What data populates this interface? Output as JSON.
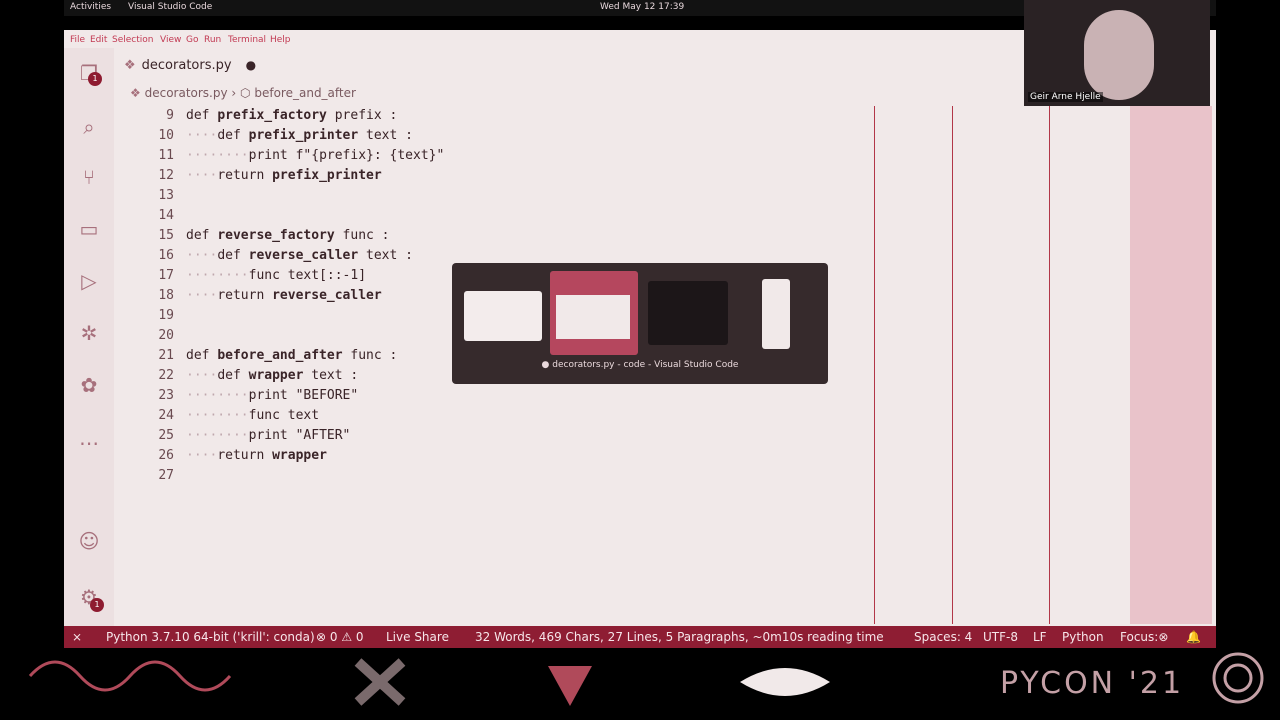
{
  "gnome": {
    "activities": "Activities",
    "app": "Visual Studio Code",
    "clock": "Wed May 12 17:39"
  },
  "menu": [
    "File",
    "Edit",
    "Selection",
    "View",
    "Go",
    "Run",
    "Terminal",
    "Help"
  ],
  "tab": {
    "filename": "decorators.py"
  },
  "breadcrumb": {
    "file": "decorators.py",
    "symbol": "before_and_after"
  },
  "activity_badges": {
    "explorer": "1",
    "accounts": "1"
  },
  "code": [
    {
      "n": "9",
      "kw": "def",
      "name": "prefix_factory",
      "rest": " prefix :"
    },
    {
      "n": "10",
      "ind": "····",
      "kw": "def",
      "name": "prefix_printer",
      "rest": " text :"
    },
    {
      "n": "11",
      "ind": "········",
      "kw": "print",
      "rest": " f\"{prefix}: {text}\""
    },
    {
      "n": "12",
      "ind": "····",
      "kw": "return",
      "name": "prefix_printer",
      "rest": ""
    },
    {
      "n": "13"
    },
    {
      "n": "14"
    },
    {
      "n": "15",
      "kw": "def",
      "name": "reverse_factory",
      "rest": " func :"
    },
    {
      "n": "16",
      "ind": "····",
      "kw": "def",
      "name": "reverse_caller",
      "rest": " text :"
    },
    {
      "n": "17",
      "ind": "········",
      "rest": "func text[::-1]"
    },
    {
      "n": "18",
      "ind": "····",
      "kw": "return",
      "name": "reverse_caller",
      "rest": ""
    },
    {
      "n": "19"
    },
    {
      "n": "20"
    },
    {
      "n": "21",
      "kw": "def",
      "name": "before_and_after",
      "rest": " func :"
    },
    {
      "n": "22",
      "ind": "····",
      "kw": "def",
      "name": "wrapper",
      "rest": " text :"
    },
    {
      "n": "23",
      "ind": "········",
      "kw": "print",
      "rest": " \"BEFORE\""
    },
    {
      "n": "24",
      "ind": "········",
      "rest": "func text"
    },
    {
      "n": "25",
      "ind": "········",
      "kw": "print",
      "rest": " \"AFTER\""
    },
    {
      "n": "26",
      "ind": "····",
      "kw": "return",
      "name": "wrapper",
      "rest": ""
    },
    {
      "n": "27"
    }
  ],
  "switcher": {
    "label": "● decorators.py - code - Visual Studio Code"
  },
  "status": {
    "remote": "⨯",
    "python": "Python 3.7.10 64-bit ('krill': conda)",
    "problems": "⊗ 0 ⚠ 0",
    "liveshare": "Live Share",
    "stats": "32 Words, 469 Chars, 27 Lines, 5 Paragraphs, ~0m10s reading time",
    "spaces": "Spaces: 4",
    "encoding": "UTF-8",
    "eol": "LF",
    "language": "Python",
    "focus": "Focus:⊗",
    "bell": "🔔"
  },
  "webcam": {
    "name": "Geir Arne Hjelle"
  },
  "branding": {
    "conf": "PYCON '21"
  }
}
